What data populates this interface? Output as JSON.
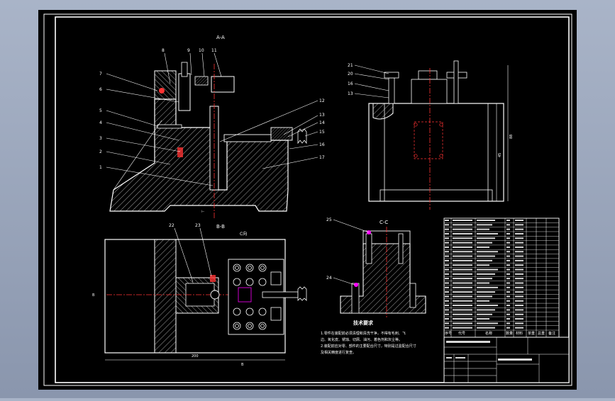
{
  "drawing": {
    "views": {
      "aa_title": "A-A",
      "bb_title": "B-B",
      "cc_title": "C-C",
      "c_arrow": "C向"
    },
    "aa_callouts": [
      "8",
      "9",
      "10",
      "11",
      "7",
      "6",
      "5",
      "4",
      "3",
      "2",
      "1",
      "12",
      "13",
      "14",
      "15",
      "16",
      "17"
    ],
    "right_callouts": [
      "21",
      "20",
      "16",
      "13"
    ],
    "bb_callouts": [
      "22",
      "23"
    ],
    "cc_callouts": [
      "25",
      "24"
    ],
    "dims": {
      "right_height_a": "88",
      "right_height_b": "45",
      "bb_width": "200",
      "bb_left": "B",
      "bb_bottom": "B"
    },
    "tech": {
      "heading": "技术要求",
      "lines": [
        "1.零件在装配前必须清理和清洗干净，不得有毛刺、飞",
        "边、氧化皮、锈蚀、切屑、油污、着色剂和灰尘等。",
        "2.装配前应对零、部件的主要配合尺寸，特别是过盈配合尺寸",
        "及相关精度进行复查。"
      ]
    },
    "title_block": {
      "header": [
        "序号",
        "代号",
        "名称",
        "数量",
        "材料",
        "单重",
        "总重",
        "备注"
      ]
    }
  }
}
